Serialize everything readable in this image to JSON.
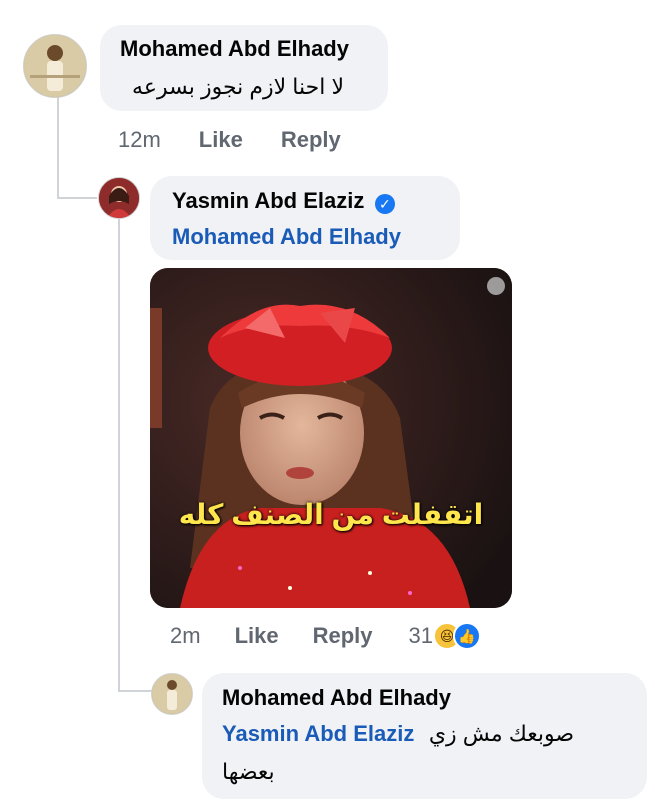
{
  "comments": [
    {
      "author": "Mohamed Abd Elhady",
      "text": "لا احنا لازم نجوز بسرعه",
      "time": "12m",
      "like_label": "Like",
      "reply_label": "Reply"
    },
    {
      "author": "Yasmin Abd Elaziz",
      "tag": "Mohamed Abd Elhady",
      "meme_caption": "اتقفلت من الصنف كله",
      "time": "2m",
      "like_label": "Like",
      "reply_label": "Reply",
      "reaction_count": "31"
    },
    {
      "author": "Mohamed Abd Elhady",
      "tag": "Yasmin Abd Elaziz",
      "text_line1": "صوبعك مش زي",
      "text_line2": "بعضها"
    }
  ],
  "icons": {
    "verified": "verified-badge-icon",
    "haha": "haha-reaction-icon",
    "like": "like-reaction-icon"
  },
  "colors": {
    "bubble": "#f0f2f5",
    "tag": "#1a5bb8",
    "verified": "#1877f2",
    "meta": "#606770"
  }
}
